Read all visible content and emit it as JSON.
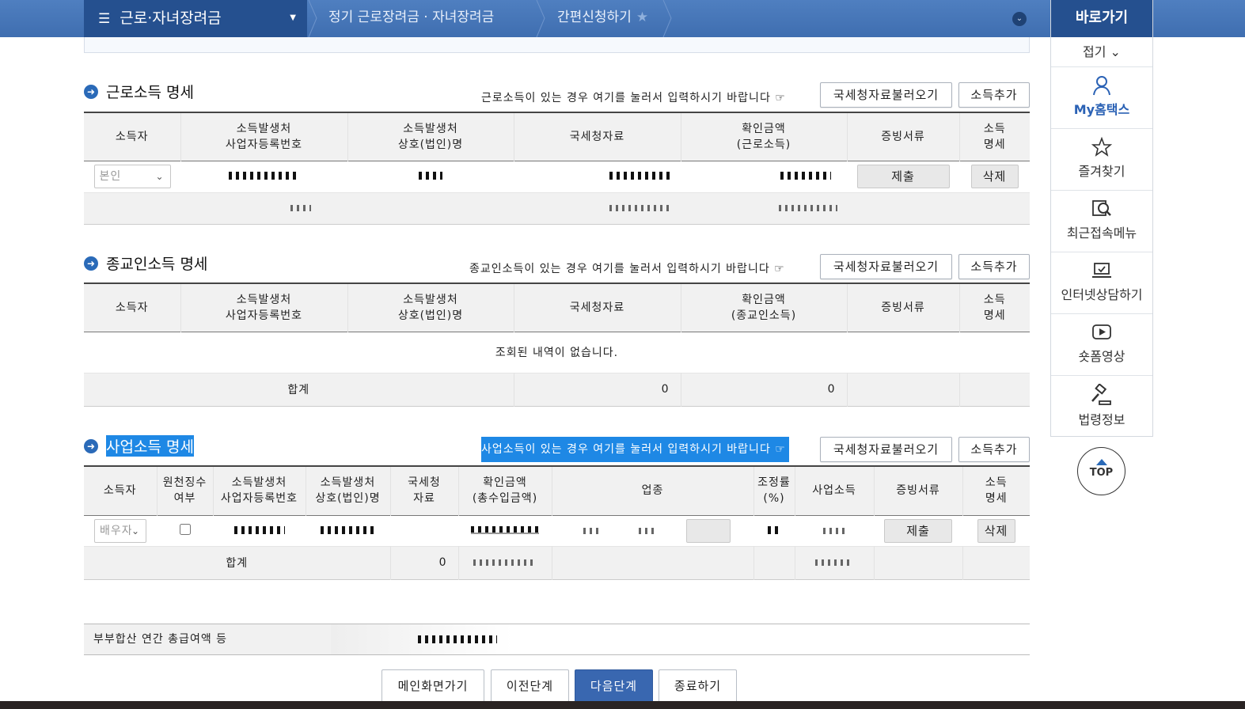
{
  "nav": {
    "menu_label": "근로·자녀장려금",
    "crumb1": "정기 근로장려금 · 자녀장려금",
    "crumb2": "간편신청하기"
  },
  "side": {
    "title": "바로가기",
    "fold": "접기",
    "items": [
      "My홈택스",
      "즐겨찾기",
      "최근접속메뉴",
      "인터넷상담하기",
      "숏폼영상",
      "법령정보"
    ],
    "top": "TOP"
  },
  "sec1": {
    "title": "근로소득 명세",
    "hint": "근로소득이 있는 경우 여기를 눌러서 입력하시기 바랍니다 ☞",
    "btn_load": "국세청자료불러오기",
    "btn_add": "소득추가",
    "headers": [
      "소득자",
      "소득발생처\n사업자등록번호",
      "소득발생처\n상호(법인)명",
      "국세청자료",
      "확인금액\n(근로소득)",
      "증빙서류",
      "소득\n명세"
    ],
    "row_select": "본인",
    "submit": "제출",
    "delete": "삭제"
  },
  "sec2": {
    "title": "종교인소득 명세",
    "hint": "종교인소득이 있는 경우 여기를 눌러서 입력하시기 바랍니다 ☞",
    "btn_load": "국세청자료불러오기",
    "btn_add": "소득추가",
    "headers": [
      "소득자",
      "소득발생처\n사업자등록번호",
      "소득발생처\n상호(법인)명",
      "국세청자료",
      "확인금액\n(종교인소득)",
      "증빙서류",
      "소득\n명세"
    ],
    "empty": "조회된 내역이 없습니다.",
    "sum_label": "합계",
    "sum_nts": "0",
    "sum_confirm": "0"
  },
  "sec3": {
    "title": "사업소득 명세",
    "hint": "사업소득이 있는 경우 여기를 눌러서 입력하시기 바랍니다 ☞",
    "btn_load": "국세청자료불러오기",
    "btn_add": "소득추가",
    "headers": [
      "소득자",
      "원천징수\n여부",
      "소득발생처\n사업자등록번호",
      "소득발생처\n상호(법인)명",
      "국세청\n자료",
      "확인금액\n(총수입금액)",
      "업종",
      "조정률\n(%)",
      "사업소득",
      "증빙서류",
      "소득\n명세"
    ],
    "row_select": "배우자",
    "submit": "제출",
    "delete": "삭제",
    "sum_label": "합계",
    "sum_nts": "0"
  },
  "footer": {
    "label": "부부합산 연간 총급여액 등"
  },
  "buttons": {
    "main": "메인화면가기",
    "prev": "이전단계",
    "next": "다음단계",
    "close": "종료하기"
  },
  "colors": {
    "brand": "#25508f",
    "accent": "#3967b0",
    "highlight": "#1e88e5"
  }
}
